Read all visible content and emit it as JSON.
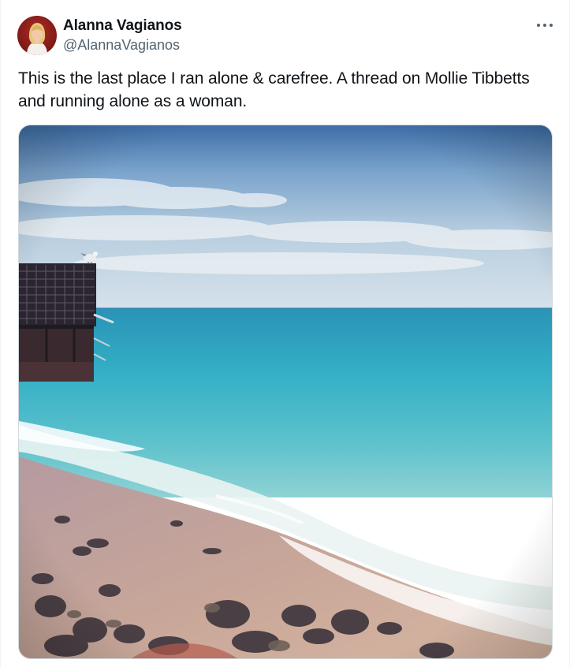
{
  "tweet": {
    "author_name": "Alanna Vagianos",
    "author_handle": "@AlannaVagianos",
    "text": "This is the last place I ran alone & carefree. A thread on Mollie Tibbetts and running alone as a woman.",
    "media_description_icon": "beach-photo",
    "more_icon": "more-horizontal-icon"
  },
  "colors": {
    "secondary_text": "#536471",
    "primary_text": "#0f1419",
    "border": "#cfd9de"
  }
}
